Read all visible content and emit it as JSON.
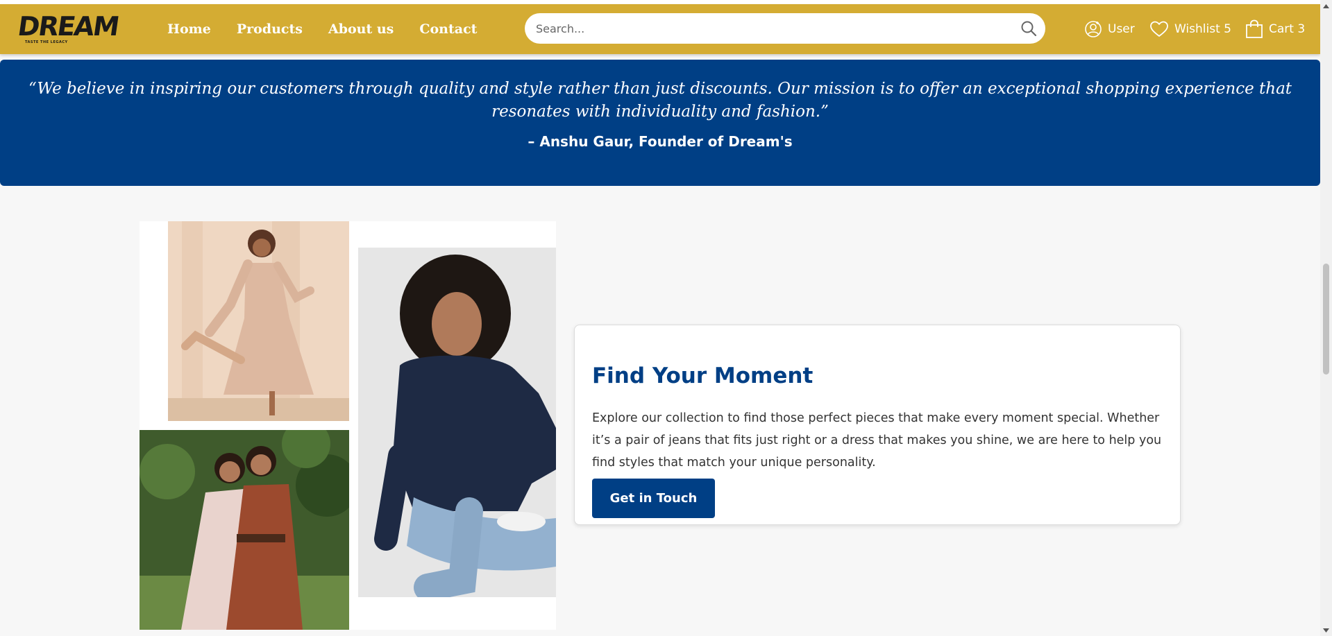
{
  "brand": {
    "logo_text": "DREAM",
    "tagline": "TASTE THE LEGACY"
  },
  "nav": {
    "items": [
      {
        "label": "Home"
      },
      {
        "label": "Products"
      },
      {
        "label": "About us"
      },
      {
        "label": "Contact"
      }
    ]
  },
  "search": {
    "placeholder": "Search...",
    "value": "",
    "icon": "search-icon"
  },
  "header_actions": {
    "user": {
      "label": "User",
      "icon": "user-icon"
    },
    "wishlist": {
      "label": "Wishlist 5",
      "icon": "heart-icon"
    },
    "cart": {
      "label": "Cart 3",
      "icon": "shopping-bag-icon"
    }
  },
  "quote": {
    "text": "“We believe in inspiring our customers through quality and style rather than just discounts. Our mission is to offer an exceptional shopping experience that resonates with individuality and fashion.”",
    "author": "– Anshu Gaur, Founder of Dream's"
  },
  "feature": {
    "title": "Find Your Moment",
    "body": "Explore our collection to find those perfect pieces that make every moment special. Whether it’s a pair of jeans that fits just right or a dress that makes you shine, we are here to help you find styles that match your unique personality.",
    "button_label": "Get in Touch"
  },
  "colors": {
    "header_bg": "#d4ac33",
    "brand_blue": "#003f85",
    "page_bg": "#f7f7f7"
  }
}
